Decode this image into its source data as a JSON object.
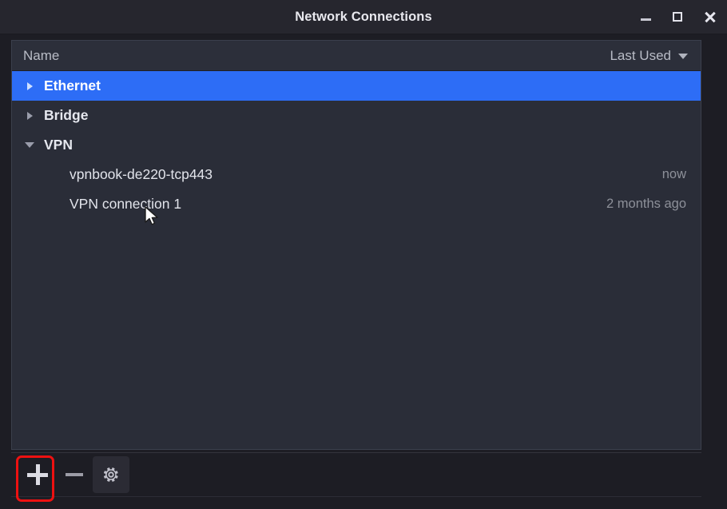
{
  "window": {
    "title": "Network Connections",
    "controls": [
      {
        "name": "minimize",
        "glyph": "_"
      },
      {
        "name": "maximize",
        "glyph": "□"
      },
      {
        "name": "close",
        "glyph": "✕"
      }
    ]
  },
  "list": {
    "columns": {
      "name": "Name",
      "last_used": "Last Used",
      "sort_indicator": "descending-caret"
    },
    "groups": [
      {
        "label": "Ethernet",
        "expanded": false,
        "selected": true,
        "last_used": "",
        "children": []
      },
      {
        "label": "Bridge",
        "expanded": false,
        "selected": false,
        "last_used": "",
        "children": []
      },
      {
        "label": "VPN",
        "expanded": true,
        "selected": false,
        "last_used": "",
        "children": [
          {
            "label": "vpnbook-de220-tcp443",
            "last_used": "now"
          },
          {
            "label": "VPN connection 1",
            "last_used": "2 months ago"
          }
        ]
      }
    ]
  },
  "toolbar": {
    "buttons": [
      {
        "name": "add-connection",
        "icon": "plus-icon",
        "highlighted": true
      },
      {
        "name": "remove-connection",
        "icon": "minus-icon",
        "highlighted": false
      },
      {
        "name": "edit-connection",
        "icon": "gear-icon",
        "highlighted": false
      }
    ]
  },
  "annotation": {
    "target": "add-connection-button",
    "color": "#ee1111"
  },
  "colors": {
    "selection": "#2d6df6",
    "list_background": "#2a2d38",
    "titlebar_background": "#26262e",
    "toolbar_background": "#1d1d24",
    "primary_text": "#e6e8ef",
    "muted_text": "#8d9099",
    "annotation": "#ee1111"
  }
}
